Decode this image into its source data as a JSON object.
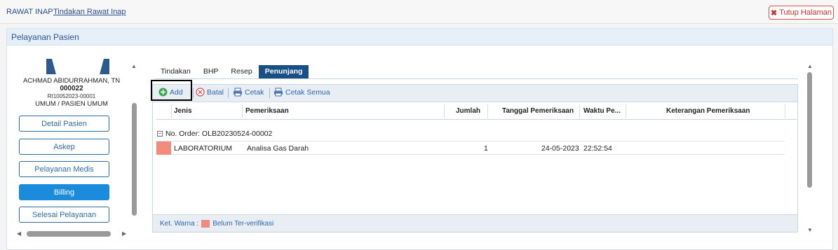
{
  "breadcrumb": {
    "level1": "RAWAT INAP",
    "level2": "Tindakan Rawat Inap"
  },
  "close_button": {
    "label": "Tutup Halaman"
  },
  "panel_title": "Pelayanan Pasien",
  "patient": {
    "name": "ACHMAD ABIDURRAHMAN, TN",
    "id": "000022",
    "registration": "RI10052023-00001",
    "payer": "UMUM / PASIEN UMUM"
  },
  "nav": [
    {
      "label": "Detail Pasien",
      "active": false
    },
    {
      "label": "Askep",
      "active": false
    },
    {
      "label": "Pelayanan Medis",
      "active": false
    },
    {
      "label": "Billing",
      "active": true
    },
    {
      "label": "Selesai Pelayanan",
      "active": false
    }
  ],
  "tabs": [
    "Tindakan",
    "BHP",
    "Resep",
    "Penunjang"
  ],
  "active_tab": "Penunjang",
  "toolbar": {
    "add": "Add",
    "cancel": "Batal",
    "print": "Cetak",
    "print_all": "Cetak Semua"
  },
  "columns": [
    "Jenis",
    "Pemeriksaan",
    "Jumlah",
    "Tanggal Pemeriksaan",
    "Waktu Pe...",
    "Keterangan Pemeriksaan"
  ],
  "group": {
    "label": "No. Order: OLB20230524-00002"
  },
  "rows": [
    {
      "jenis": "LABORATORIUM",
      "pemeriksaan": "Analisa Gas Darah",
      "jumlah": "1",
      "tanggal": "24-05-2023",
      "waktu": "22:52:54",
      "keterangan": ""
    }
  ],
  "legend": {
    "label": "Ket. Warna :",
    "item": "Belum Ter-verifikasi"
  },
  "colors": {
    "accent": "#174f86",
    "unverified": "#f28b7b",
    "active_nav": "#1a8cdb"
  }
}
